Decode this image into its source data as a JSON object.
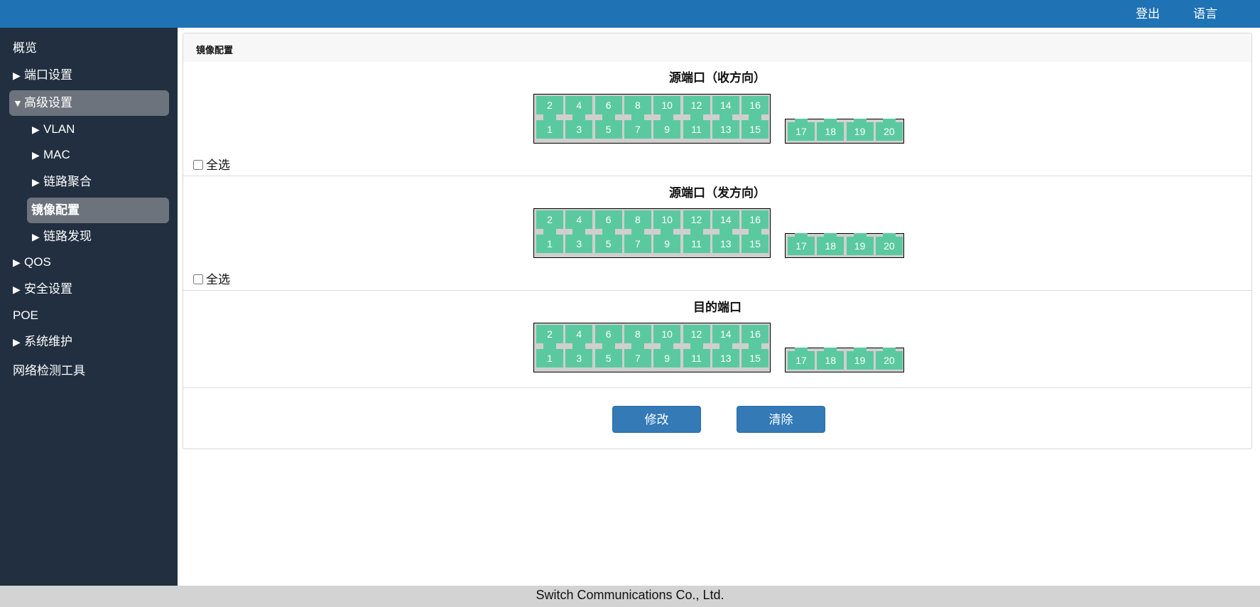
{
  "topbar": {
    "logout_label": "登出",
    "language_label": "语言"
  },
  "sidebar": {
    "items": [
      {
        "label": "概览",
        "arrow": ""
      },
      {
        "label": "端口设置",
        "arrow": "▶"
      },
      {
        "label": "高级设置",
        "arrow": "▼"
      },
      {
        "label": "VLAN",
        "arrow": "▶"
      },
      {
        "label": "MAC",
        "arrow": "▶"
      },
      {
        "label": "链路聚合",
        "arrow": "▶"
      },
      {
        "label": "镜像配置",
        "arrow": ""
      },
      {
        "label": "链路发现",
        "arrow": "▶"
      },
      {
        "label": "QOS",
        "arrow": "▶"
      },
      {
        "label": "安全设置",
        "arrow": "▶"
      },
      {
        "label": "POE",
        "arrow": ""
      },
      {
        "label": "系统维护",
        "arrow": "▶"
      },
      {
        "label": "网络检测工具",
        "arrow": ""
      }
    ]
  },
  "panel": {
    "title": "镜像配置"
  },
  "ports": {
    "top_row": [
      "2",
      "4",
      "6",
      "8",
      "10",
      "12",
      "14",
      "16"
    ],
    "bottom_row": [
      "1",
      "3",
      "5",
      "7",
      "9",
      "11",
      "13",
      "15"
    ],
    "sfp_row": [
      "17",
      "18",
      "19",
      "20"
    ]
  },
  "sections": [
    {
      "title": "源端口（收方向）",
      "select_all_label": "全选"
    },
    {
      "title": "源端口（发方向）",
      "select_all_label": "全选"
    },
    {
      "title": "目的端口",
      "select_all_label": ""
    }
  ],
  "buttons": {
    "modify_label": "修改",
    "clear_label": "清除"
  },
  "footer": {
    "text": "Switch Communications Co., Ltd."
  },
  "colors": {
    "topbar": "#1f72b4",
    "sidebar": "#212f40",
    "port": "#5bc9a0",
    "button": "#337ab7",
    "active_nav": "#6c737d"
  }
}
